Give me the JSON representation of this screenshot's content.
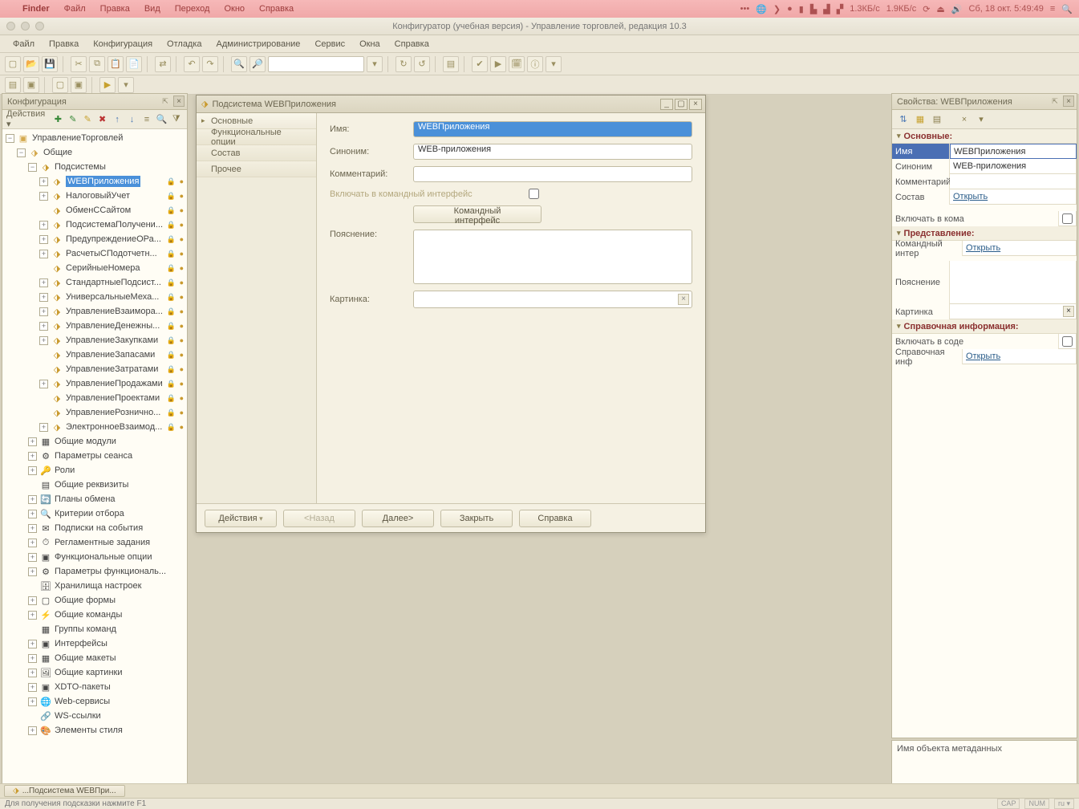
{
  "macos": {
    "finder": "Finder",
    "menus": [
      "Файл",
      "Правка",
      "Вид",
      "Переход",
      "Окно",
      "Справка"
    ],
    "datetime": "Сб, 18 окт.  5:49:49",
    "net_up": "1.3КБ/с",
    "net_dn": "1.9КБ/с"
  },
  "window_title": "Конфигуратор (учебная версия) - Управление торговлей, редакция 10.3",
  "main_menu": [
    "Файл",
    "Правка",
    "Конфигурация",
    "Отладка",
    "Администрирование",
    "Сервис",
    "Окна",
    "Справка"
  ],
  "tree_panel": {
    "title": "Конфигурация",
    "actions_label": "Действия"
  },
  "tree": {
    "root": "УправлениеТорговлей",
    "common": "Общие",
    "subsystems": "Подсистемы",
    "subs": [
      "WEBПриложения",
      "НалоговыйУчет",
      "ОбменССайтом",
      "ПодсистемаПолучени...",
      "ПредупреждениеОРа...",
      "РасчетыСПодотчетн...",
      "СерийныеНомера",
      "СтандартныеПодсист...",
      "УниверсальныеМеха...",
      "УправлениеВзаимора...",
      "УправлениеДенежны...",
      "УправлениеЗакупками",
      "УправлениеЗапасами",
      "УправлениеЗатратами",
      "УправлениеПродажами",
      "УправлениеПроектами",
      "УправлениеРознично...",
      "ЭлектронноеВзаимод..."
    ],
    "common_items": [
      "Общие модули",
      "Параметры сеанса",
      "Роли",
      "Общие реквизиты",
      "Планы обмена",
      "Критерии отбора",
      "Подписки на события",
      "Регламентные задания",
      "Функциональные опции",
      "Параметры функциональ...",
      "Хранилища настроек",
      "Общие формы",
      "Общие команды",
      "Группы команд",
      "Интерфейсы",
      "Общие макеты",
      "Общие картинки",
      "XDTO-пакеты",
      "Web-сервисы",
      "WS-ссылки",
      "Элементы стиля"
    ]
  },
  "editor": {
    "title": "Подсистема WEBПриложения",
    "nav": [
      "Основные",
      "Функциональные опции",
      "Состав",
      "Прочее"
    ],
    "lbl_name": "Имя:",
    "val_name": "WEBПриложения",
    "lbl_syn": "Синоним:",
    "val_syn": "WEB-приложения",
    "lbl_comment": "Комментарий:",
    "val_comment": "",
    "lbl_include": "Включать в командный интерфейс",
    "btn_cmdiface": "Командный интерфейс",
    "lbl_expl": "Пояснение:",
    "lbl_pic": "Картинка:",
    "footer": {
      "actions": "Действия",
      "back": "<Назад",
      "next": "Далее>",
      "close": "Закрыть",
      "help": "Справка"
    }
  },
  "props": {
    "title": "Свойства: WEBПриложения",
    "groups": {
      "main": "Основные:",
      "repr": "Представление:",
      "help": "Справочная информация:"
    },
    "rows": {
      "name_k": "Имя",
      "name_v": "WEBПриложения",
      "syn_k": "Синоним",
      "syn_v": "WEB-приложения",
      "com_k": "Комментарий",
      "com_v": "",
      "comp_k": "Состав",
      "comp_v": "Открыть",
      "incl_k": "Включать в кома",
      "cmd_k": "Командный интер",
      "cmd_v": "Открыть",
      "expl_k": "Пояснение",
      "expl_v": "",
      "pic_k": "Картинка",
      "pic_v": "",
      "inclh_k": "Включать в соде",
      "helpinf_k": "Справочная инф",
      "helpinf_v": "Открыть"
    },
    "desc": "Имя объекта метаданных"
  },
  "taskbar": {
    "tab": "...Подсистема WEBПри..."
  },
  "status": {
    "hint": "Для получения подсказки нажмите F1",
    "cap": "CAP",
    "num": "NUM",
    "lang": "ru"
  }
}
